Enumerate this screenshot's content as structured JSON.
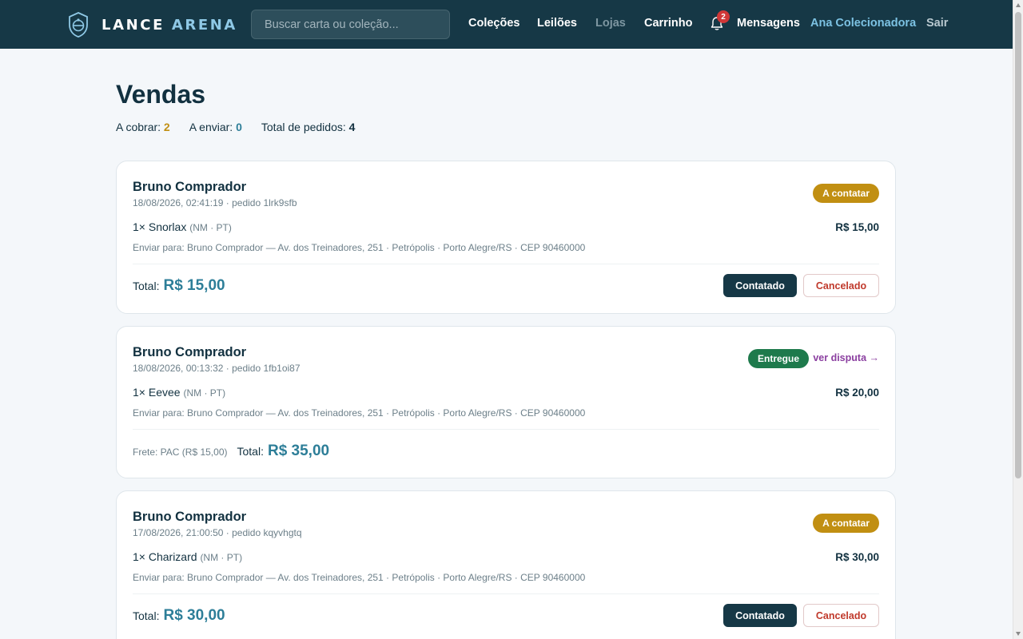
{
  "app": {
    "brand_main": "LANCE",
    "brand_accent": "ARENA",
    "search_placeholder": "Buscar carta ou coleção...",
    "nav": {
      "collections": "Coleções",
      "auctions": "Leilões",
      "stores": "Lojas",
      "cart": "Carrinho",
      "notifications_count": "2",
      "messages": "Mensagens",
      "user": "Ana Colecionadora",
      "logout": "Sair"
    }
  },
  "page": {
    "title": "Vendas",
    "summary": {
      "to_charge_label": "A cobrar:",
      "to_charge_value": "2",
      "to_ship_label": "A enviar:",
      "to_ship_value": "0",
      "total_orders_label": "Total de pedidos:",
      "total_orders_value": "4"
    }
  },
  "orders": [
    {
      "buyer": "Bruno Comprador",
      "meta": "18/08/2026, 02:41:19 · pedido 1lrk9sfb",
      "status": "A contatar",
      "item": "1× Snorlax",
      "item_condition": "(NM · PT)",
      "item_price": "R$ 15,00",
      "ship_to": "Enviar para: Bruno Comprador — Av. dos Treinadores, 251 · Petrópolis · Porto Alegre/RS · CEP 90460000",
      "total_label": "Total:",
      "total": "R$ 15,00",
      "action_primary": "Contatado",
      "action_secondary": "Cancelado"
    },
    {
      "buyer": "Bruno Comprador",
      "meta": "18/08/2026, 00:13:32 · pedido 1fb1oi87",
      "status": "Entregue",
      "dispute_link": "ver disputa →",
      "item": "1× Eevee",
      "item_condition": "(NM · PT)",
      "item_price": "R$ 20,00",
      "ship_to": "Enviar para: Bruno Comprador — Av. dos Treinadores, 251 · Petrópolis · Porto Alegre/RS · CEP 90460000",
      "freight": "Frete: PAC (R$ 15,00)",
      "total_label": "Total:",
      "total": "R$ 35,00"
    },
    {
      "buyer": "Bruno Comprador",
      "meta": "17/08/2026, 21:00:50 · pedido kqyvhgtq",
      "status": "A contatar",
      "item": "1× Charizard",
      "item_condition": "(NM · PT)",
      "item_price": "R$ 30,00",
      "ship_to": "Enviar para: Bruno Comprador — Av. dos Treinadores, 251 · Petrópolis · Porto Alegre/RS · CEP 90460000",
      "total_label": "Total:",
      "total": "R$ 30,00",
      "action_primary": "Contatado",
      "action_secondary": "Cancelado"
    }
  ],
  "colors": {
    "nav_bg": "#163846",
    "accent_teal": "#2d7e98",
    "status_to_contact": "#c18f12",
    "status_delivered": "#1e7a4c",
    "dispute_link": "#8b3fa0",
    "cancel_text": "#c0392b"
  }
}
